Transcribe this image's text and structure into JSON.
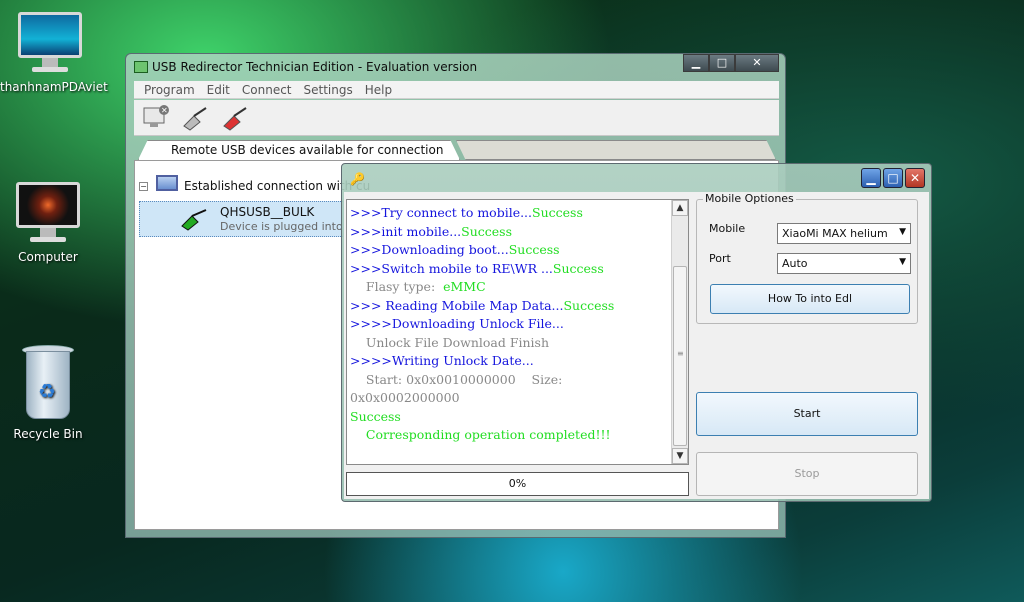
{
  "desktop": {
    "icons": [
      {
        "label": "thanhnamPDAviet"
      },
      {
        "label": "Computer"
      },
      {
        "label": "Recycle Bin"
      }
    ]
  },
  "main_window": {
    "title": "USB Redirector Technician Edition - Evaluation version",
    "menu": [
      "Program",
      "Edit",
      "Connect",
      "Settings",
      "Help"
    ],
    "tab_label": "Remote USB devices available for connection",
    "tree_root_label": "Established connection with cu",
    "device": {
      "name": "QHSUSB__BULK",
      "status": "Device is plugged into 1-2"
    }
  },
  "dialog": {
    "log": [
      {
        "text": ">>>Try connect to mobile...",
        "color": "blue",
        "suffix": "Success"
      },
      {
        "text": ">>>init mobile...",
        "color": "blue",
        "suffix": "Success"
      },
      {
        "text": ">>>Downloading boot...",
        "color": "blue",
        "suffix": "Success"
      },
      {
        "text": ">>>Switch mobile to RE\\WR ...",
        "color": "blue",
        "suffix": "Success"
      },
      {
        "text": "    Flasy type:  ",
        "color": "gray",
        "suffix": "eMMC"
      },
      {
        "text": ">>> Reading Mobile Map Data...",
        "color": "blue",
        "suffix": "Success"
      },
      {
        "text": ">>>>Downloading Unlock File...",
        "color": "blue",
        "suffix": ""
      },
      {
        "text": "    Unlock File Download Finish",
        "color": "gray",
        "suffix": ""
      },
      {
        "text": ">>>>Writing Unlock Date...",
        "color": "blue",
        "suffix": ""
      },
      {
        "text": "    Start: 0x0x0010000000    Size:",
        "color": "gray",
        "suffix": ""
      },
      {
        "text": "0x0x0002000000",
        "color": "gray",
        "suffix": ""
      },
      {
        "text": "",
        "color": "green",
        "suffix": "Success"
      },
      {
        "text": "",
        "color": "green",
        "suffix": "    Corresponding operation completed!!!"
      }
    ],
    "progress_text": "0%",
    "progress_value": 0,
    "group_title": "Mobile Optiones",
    "mobile_label": "Mobile",
    "mobile_value": "XiaoMi MAX helium",
    "port_label": "Port",
    "port_value": "Auto",
    "how_to_button": "How To into Edl",
    "start_button": "Start",
    "stop_button": "Stop"
  },
  "colors": {
    "log_blue": "#1414dd",
    "log_green": "#22dd22",
    "log_gray": "#888888"
  }
}
